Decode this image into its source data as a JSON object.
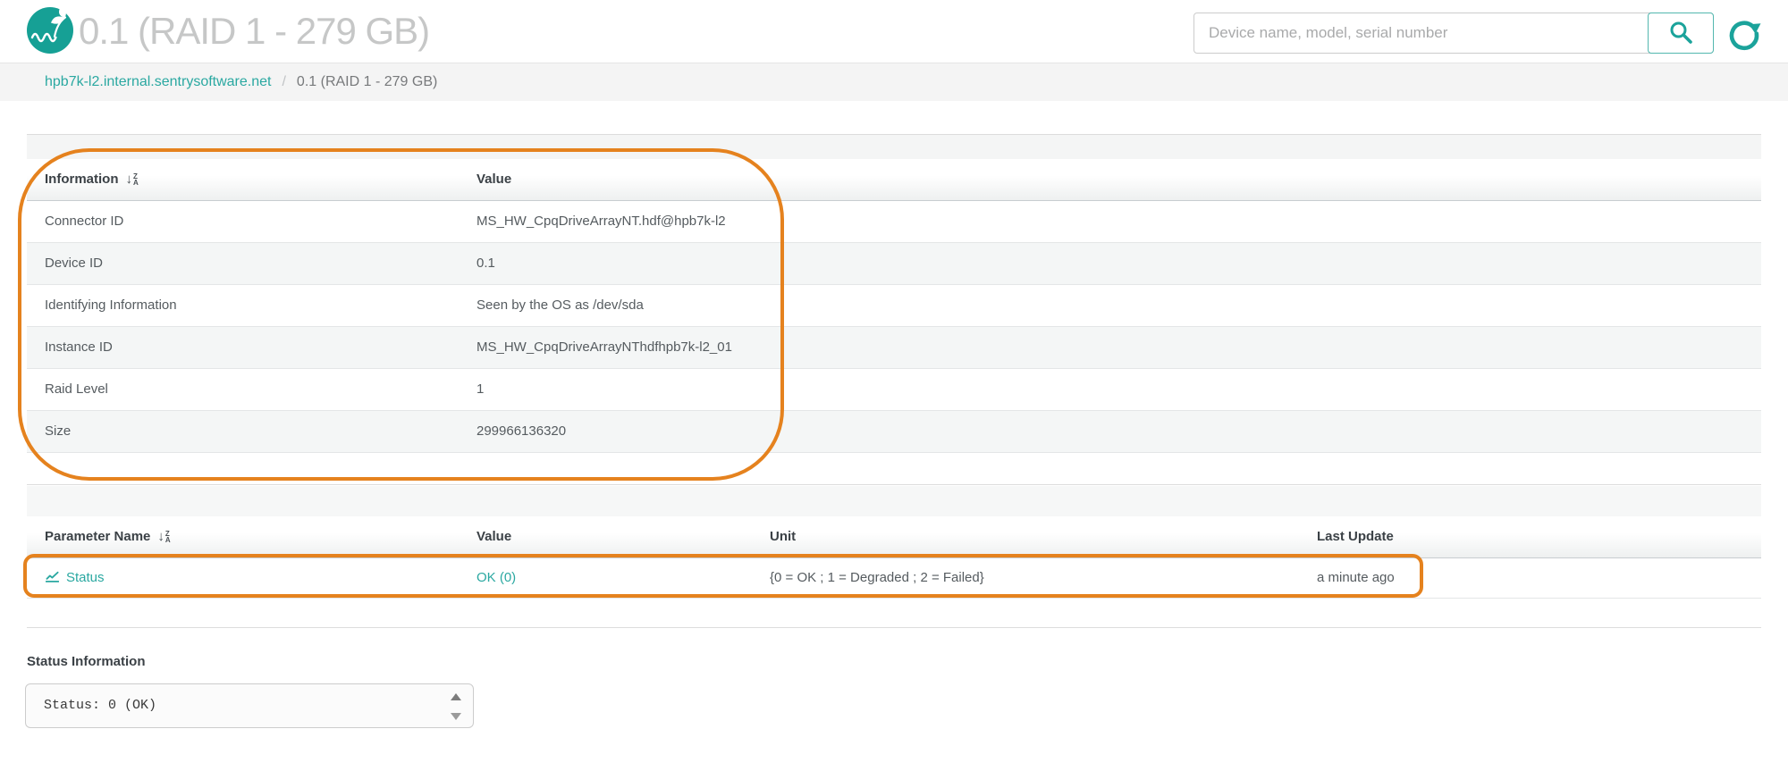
{
  "header": {
    "title": "0.1 (RAID 1 - 279 GB)",
    "search_placeholder": "Device name, model, serial number"
  },
  "breadcrumb": {
    "host": "hpb7k-l2.internal.sentrysoftware.net",
    "separator": "/",
    "current": "0.1 (RAID 1 - 279 GB)"
  },
  "icons": {
    "sort_top": "Z",
    "sort_bottom": "A"
  },
  "info_table": {
    "col_headers": [
      "Information",
      "Value"
    ],
    "rows": [
      [
        "Connector ID",
        "MS_HW_CpqDriveArrayNT.hdf@hpb7k-l2"
      ],
      [
        "Device ID",
        "0.1"
      ],
      [
        "Identifying Information",
        "Seen by the OS as /dev/sda"
      ],
      [
        "Instance ID",
        "MS_HW_CpqDriveArrayNThdfhpb7k-l2_01"
      ],
      [
        "Raid Level",
        "1"
      ],
      [
        "Size",
        "299966136320"
      ]
    ]
  },
  "param_table": {
    "col_headers": [
      "Parameter Name",
      "Value",
      "Unit",
      "Last Update"
    ],
    "rows": [
      {
        "name": "Status",
        "value": "OK (0)",
        "unit": "{0 = OK ; 1 = Degraded ; 2 = Failed}",
        "last_update": "a minute ago"
      }
    ]
  },
  "status_info": {
    "label": "Status Information",
    "content": "Status: 0 (OK)"
  },
  "colors": {
    "teal": "#1ba39b",
    "teal_link": "#2aa8a1",
    "orange_annotation": "#e5821e"
  }
}
